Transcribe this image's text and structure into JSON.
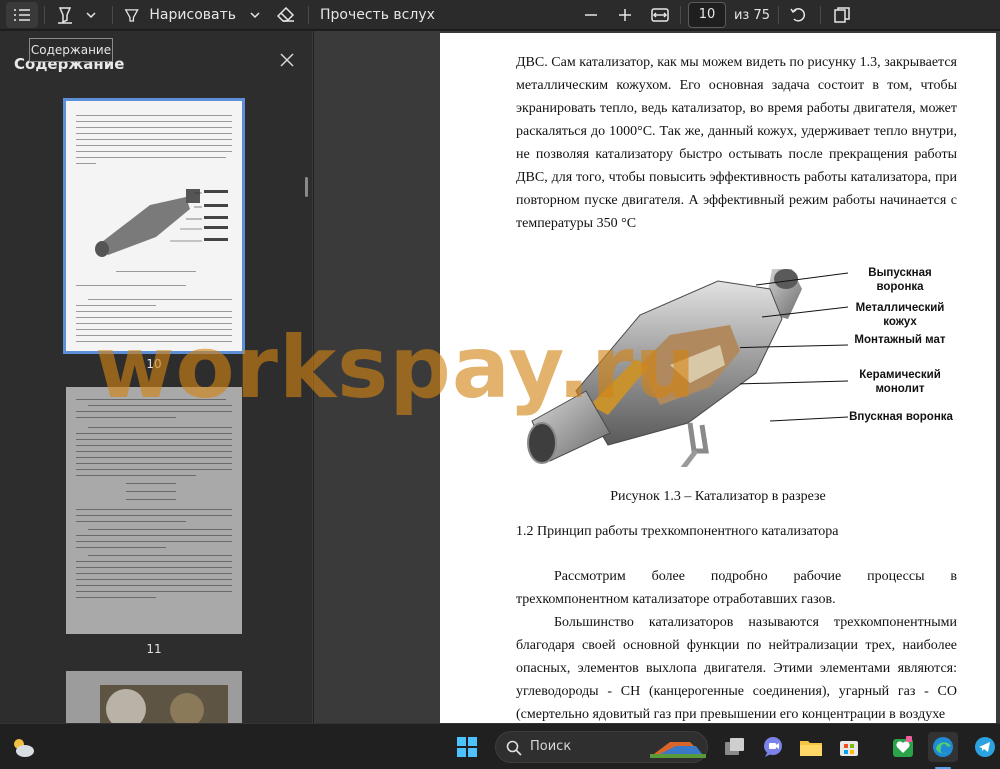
{
  "toolbar": {
    "draw_label": "Нарисовать",
    "read_aloud_label": "Прочесть вслух",
    "page_current": "10",
    "page_total_label": "из 75"
  },
  "sidebar": {
    "title": "Содержание",
    "tooltip": "Содержание",
    "thumbnails": [
      {
        "label": "10"
      },
      {
        "label": "11"
      }
    ]
  },
  "document": {
    "paragraph1": "ДВС. Сам катализатор, как мы можем видеть по рисунку 1.3, закрывается металлическим кожухом. Его основная задача состоит в том, чтобы экранировать тепло, ведь катализатор, во время работы двигателя, может раскаляться до 1000°С. Так же, данный кожух, удерживает тепло внутри, не позволяя катализатору быстро остывать после прекращения работы ДВС, для того, чтобы повысить эффективность работы катализатора, при повторном пуске двигателя. А эффективный режим работы начинается с температуры 350 °С",
    "figure_labels": [
      "Выпускная воронка",
      "Металлический кожух",
      "Монтажный мат",
      "Керамический монолит",
      "Впускная воронка"
    ],
    "figure_caption": "Рисунок 1.3 – Катализатор в разрезе",
    "section_heading": "1.2 Принцип работы трехкомпонентного катализатора",
    "paragraph2": "Рассмотрим более подробно рабочие процессы в трехкомпонентном катализаторе отработавших газов.",
    "paragraph3": "Большинство катализаторов называются трехкомпонентными благодаря своей основной функции по нейтрализации трех, наиболее опасных, элементов выхлопа двигателя. Этими элементами являются: углеводороды - CH (канцерогенные соединения), угарный газ - CO (смертельно ядовитый газ при превышении его концентрации в воздухе"
  },
  "watermark": "workspay.ru",
  "taskbar": {
    "search_label": "Поиск"
  },
  "colors": {
    "accent": "#5c8fd6",
    "watermark": "#d2821a"
  }
}
